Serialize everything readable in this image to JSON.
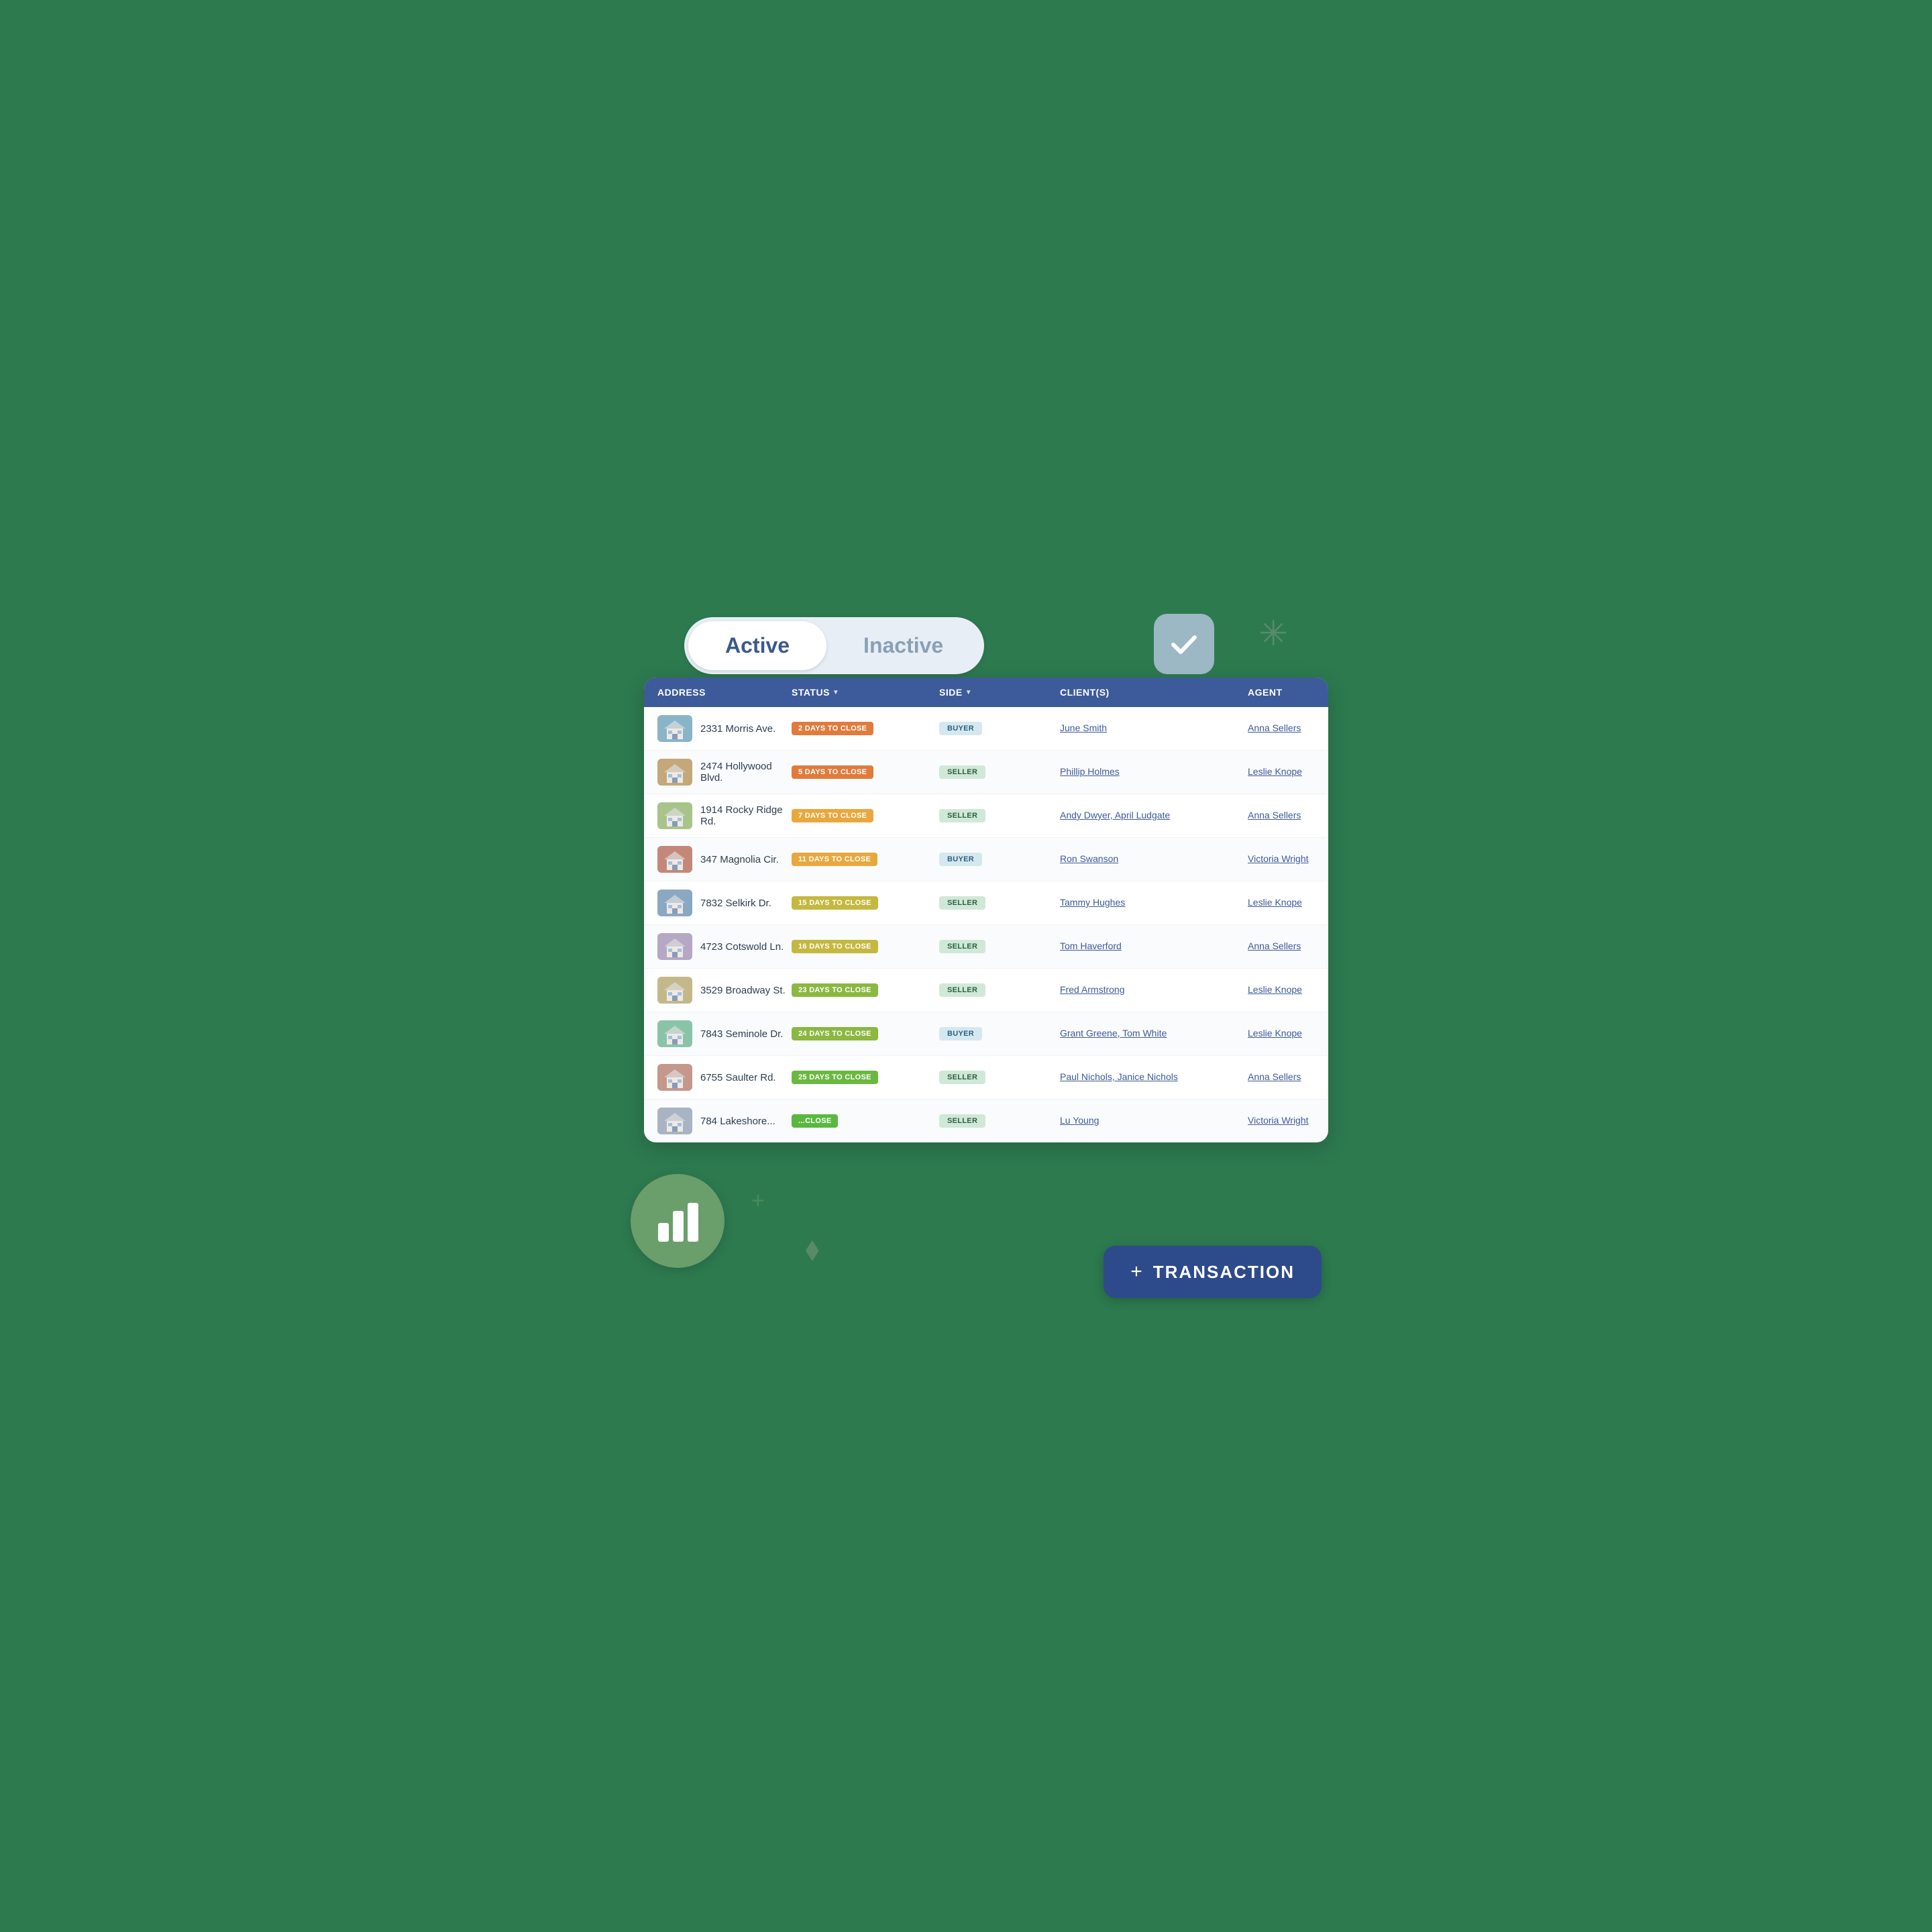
{
  "toggle": {
    "active_label": "Active",
    "inactive_label": "Inactive"
  },
  "table": {
    "headers": [
      {
        "key": "address",
        "label": "ADDRESS",
        "sortable": false
      },
      {
        "key": "status",
        "label": "STATUS",
        "sortable": true
      },
      {
        "key": "side",
        "label": "SIDE",
        "sortable": true
      },
      {
        "key": "clients",
        "label": "CLIENT(S)",
        "sortable": false
      },
      {
        "key": "agent",
        "label": "AGENT",
        "sortable": false
      },
      {
        "key": "action",
        "label": "",
        "sortable": false
      }
    ],
    "rows": [
      {
        "address": "2331 Morris Ave.",
        "status": "2 DAYS TO CLOSE",
        "status_class": "status-2",
        "side": "BUYER",
        "side_type": "buyer",
        "clients": "June Smith",
        "agent": "Anna Sellers"
      },
      {
        "address": "2474 Hollywood Blvd.",
        "status": "5 DAYS TO CLOSE",
        "status_class": "status-5",
        "side": "SELLER",
        "side_type": "seller",
        "clients": "Phillip Holmes",
        "agent": "Leslie Knope"
      },
      {
        "address": "1914 Rocky Ridge Rd.",
        "status": "7 DAYS TO CLOSE",
        "status_class": "status-7",
        "side": "SELLER",
        "side_type": "seller",
        "clients": "Andy Dwyer, April Ludgate",
        "agent": "Anna Sellers"
      },
      {
        "address": "347 Magnolia Cir.",
        "status": "11 DAYS TO CLOSE",
        "status_class": "status-11",
        "side": "BUYER",
        "side_type": "buyer",
        "clients": "Ron Swanson",
        "agent": "Victoria Wright"
      },
      {
        "address": "7832 Selkirk Dr.",
        "status": "15 DAYS TO CLOSE",
        "status_class": "status-15",
        "side": "SELLER",
        "side_type": "seller",
        "clients": "Tammy Hughes",
        "agent": "Leslie Knope"
      },
      {
        "address": "4723 Cotswold Ln.",
        "status": "16 DAYS TO CLOSE",
        "status_class": "status-16",
        "side": "SELLER",
        "side_type": "seller",
        "clients": "Tom Haverford",
        "agent": "Anna Sellers"
      },
      {
        "address": "3529 Broadway St.",
        "status": "23 DAYS TO CLOSE",
        "status_class": "status-23",
        "side": "SELLER",
        "side_type": "seller",
        "clients": "Fred Armstrong",
        "agent": "Leslie Knope"
      },
      {
        "address": "7843 Seminole Dr.",
        "status": "24 DAYS TO CLOSE",
        "status_class": "status-24",
        "side": "BUYER",
        "side_type": "buyer",
        "clients": "Grant Greene, Tom White",
        "agent": "Leslie Knope"
      },
      {
        "address": "6755 Saulter Rd.",
        "status": "25 DAYS TO CLOSE",
        "status_class": "status-25",
        "side": "SELLER",
        "side_type": "seller",
        "clients": "Paul Nichols, Janice Nichols",
        "agent": "Anna Sellers"
      },
      {
        "address": "784 Lakeshore...",
        "status": "...CLOSE",
        "status_class": "status-last",
        "side": "SELLER",
        "side_type": "seller",
        "clients": "Lu Young",
        "agent": "Victoria Wright"
      }
    ]
  },
  "add_transaction": {
    "plus": "+",
    "label": "TRANSACTION"
  },
  "decorators": {
    "asterisk": "*",
    "small_plus": "+",
    "sparkle": "◇"
  }
}
